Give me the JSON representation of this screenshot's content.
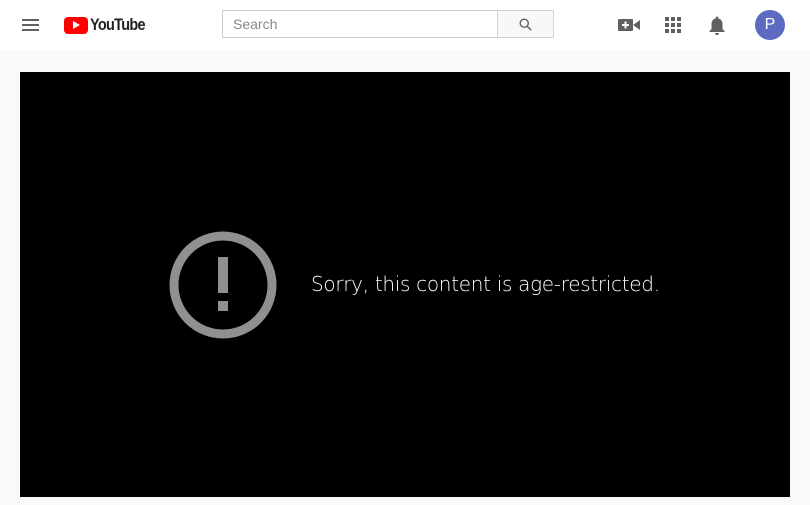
{
  "masthead": {
    "menu_icon": "hamburger-menu-icon",
    "logo_text": "YouTube",
    "search": {
      "placeholder": "Search",
      "value": "",
      "button_icon": "search-icon"
    },
    "actions": [
      {
        "name": "create-video-button",
        "icon": "video-camera-plus-icon"
      },
      {
        "name": "apps-button",
        "icon": "apps-grid-icon"
      },
      {
        "name": "notifications-button",
        "icon": "bell-icon"
      }
    ],
    "avatar_initial": "P",
    "avatar_color": "#5c6bc0"
  },
  "player": {
    "error_icon": "exclamation-circle-icon",
    "error_message": "Sorry, this content is age-restricted."
  },
  "colors": {
    "brand_red": "#ff0000",
    "player_bg": "#000000",
    "page_bg": "#f9f9f9",
    "icon_gray": "#909090"
  }
}
